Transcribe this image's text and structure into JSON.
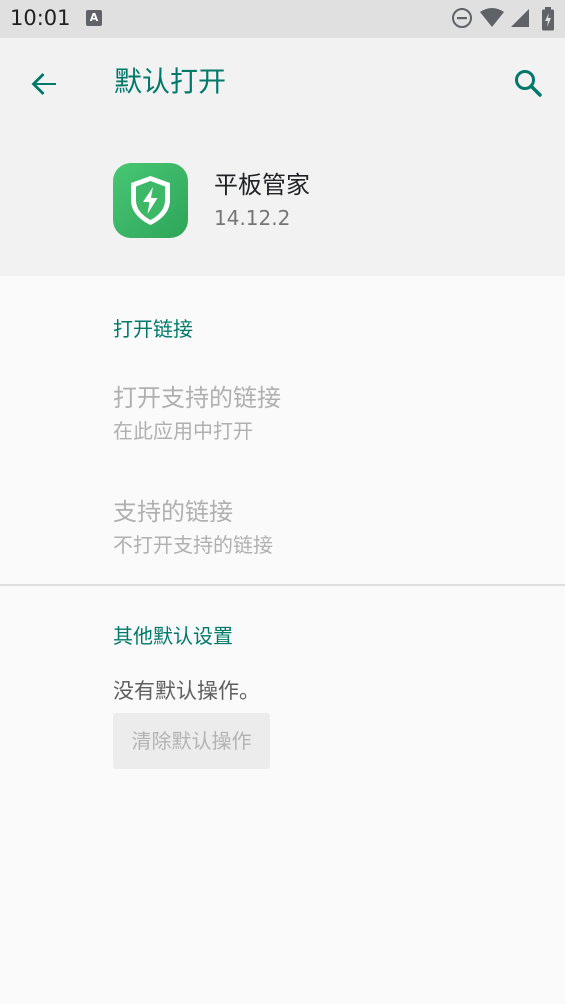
{
  "status_bar": {
    "time": "10:01",
    "notification_letter": "A",
    "icons": [
      "do-not-disturb-icon",
      "wifi-icon",
      "signal-icon",
      "battery-icon"
    ]
  },
  "toolbar": {
    "title": "默认打开",
    "back_icon": "arrow-left-icon",
    "search_icon": "search-icon"
  },
  "app": {
    "name": "平板管家",
    "version": "14.12.2",
    "icon": "shield-bolt-icon"
  },
  "open_links": {
    "header": "打开链接",
    "items": [
      {
        "title": "打开支持的链接",
        "summary": "在此应用中打开"
      },
      {
        "title": "支持的链接",
        "summary": "不打开支持的链接"
      }
    ]
  },
  "other_defaults": {
    "header": "其他默认设置",
    "message": "没有默认操作。",
    "clear_button": "清除默认操作"
  },
  "colors": {
    "accent": "#00796b",
    "app_icon_green": "#3cb866",
    "disabled_text": "#b0b0b0"
  }
}
